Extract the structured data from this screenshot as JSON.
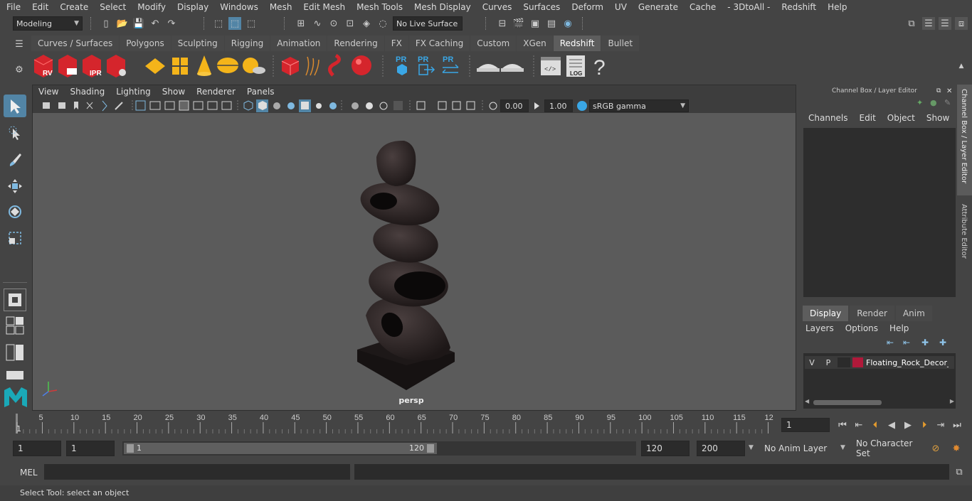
{
  "menubar": [
    "File",
    "Edit",
    "Create",
    "Select",
    "Modify",
    "Display",
    "Windows",
    "Mesh",
    "Edit Mesh",
    "Mesh Tools",
    "Mesh Display",
    "Curves",
    "Surfaces",
    "Deform",
    "UV",
    "Generate",
    "Cache",
    "- 3DtoAll -",
    "Redshift",
    "Help"
  ],
  "status": {
    "mode": "Modeling",
    "live_surface": "No Live Surface"
  },
  "shelf_tabs": [
    "Curves / Surfaces",
    "Polygons",
    "Sculpting",
    "Rigging",
    "Animation",
    "Rendering",
    "FX",
    "FX Caching",
    "Custom",
    "XGen",
    "Redshift",
    "Bullet"
  ],
  "shelf_active": "Redshift",
  "shelf_labels": {
    "rv": "RV",
    "ipr": "IPR",
    "pr": "PR",
    "log": "LOG",
    "help": "?"
  },
  "viewport": {
    "menu": [
      "View",
      "Shading",
      "Lighting",
      "Show",
      "Renderer",
      "Panels"
    ],
    "exposure": "0.00",
    "gamma": "1.00",
    "colorspace": "sRGB gamma",
    "camera": "persp"
  },
  "channel_box": {
    "title": "Channel Box / Layer Editor",
    "menu": [
      "Channels",
      "Edit",
      "Object",
      "Show"
    ]
  },
  "layer_editor": {
    "tabs": [
      "Display",
      "Render",
      "Anim"
    ],
    "menu": [
      "Layers",
      "Options",
      "Help"
    ],
    "layer": {
      "v": "V",
      "p": "P",
      "name": "Floating_Rock_Decor_",
      "color": "#b0193a"
    }
  },
  "side_tabs": [
    "Channel Box / Layer Editor",
    "Attribute Editor"
  ],
  "timeline": {
    "ticks": [
      "5",
      "10",
      "15",
      "20",
      "25",
      "30",
      "35",
      "40",
      "45",
      "50",
      "55",
      "60",
      "65",
      "70",
      "75",
      "80",
      "85",
      "90",
      "95",
      "100",
      "105",
      "110",
      "115",
      "12"
    ],
    "start_label": "1",
    "current_frame": "1"
  },
  "range": {
    "start": "1",
    "inner_start": "1",
    "slider_start": "1",
    "slider_end": "120",
    "end": "120",
    "max": "200",
    "anim_layer": "No Anim Layer",
    "character_set": "No Character Set"
  },
  "cmd": {
    "label": "MEL"
  },
  "help_line": "Select Tool: select an object"
}
